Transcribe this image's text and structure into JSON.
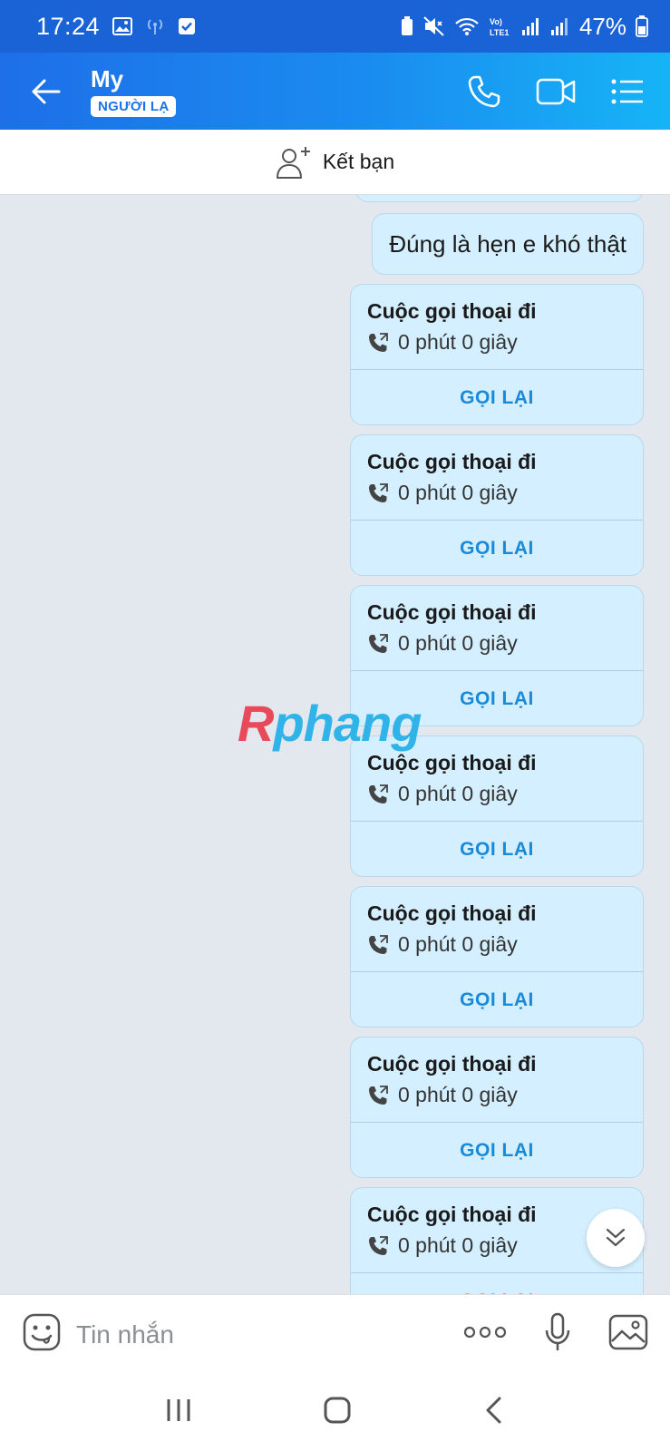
{
  "status_bar": {
    "time": "17:24",
    "battery": "47%",
    "network": "Vo) LTE1"
  },
  "header": {
    "name": "My",
    "badge": "NGƯỜI LẠ"
  },
  "friend_bar": {
    "label": "Kết bạn"
  },
  "messages": {
    "text_bubble": "Đúng là hẹn e khó thật",
    "calls": [
      {
        "title": "Cuộc gọi thoại đi",
        "duration": "0 phút 0 giây",
        "action": "GỌI LẠI"
      },
      {
        "title": "Cuộc gọi thoại đi",
        "duration": "0 phút 0 giây",
        "action": "GỌI LẠI"
      },
      {
        "title": "Cuộc gọi thoại đi",
        "duration": "0 phút 0 giây",
        "action": "GỌI LẠI"
      },
      {
        "title": "Cuộc gọi thoại đi",
        "duration": "0 phút 0 giây",
        "action": "GỌI LẠI"
      },
      {
        "title": "Cuộc gọi thoại đi",
        "duration": "0 phút 0 giây",
        "action": "GỌI LẠI"
      },
      {
        "title": "Cuộc gọi thoại đi",
        "duration": "0 phút 0 giây",
        "action": "GỌI LẠI"
      },
      {
        "title": "Cuộc gọi thoại đi",
        "duration": "0 phút 0 giây",
        "action": "GỌI LẠI"
      }
    ]
  },
  "watermark": {
    "first": "R",
    "rest": "phang"
  },
  "input_bar": {
    "placeholder": "Tin nhắn"
  },
  "colors": {
    "header_start": "#1e6fe8",
    "header_end": "#16b4f6",
    "bubble": "#d4efff",
    "action": "#1a8ad8"
  }
}
